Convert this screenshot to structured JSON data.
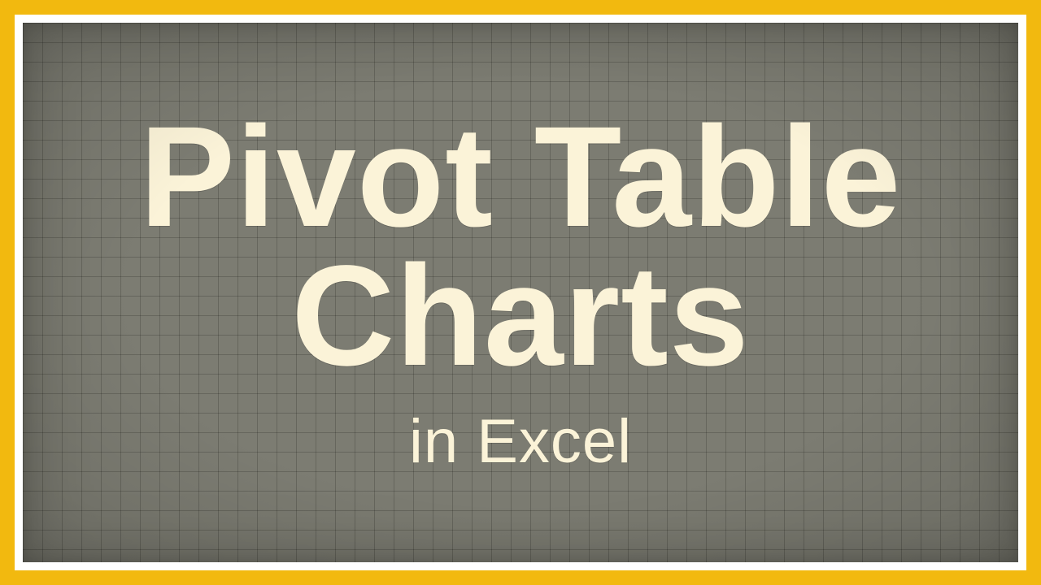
{
  "card": {
    "title_line1": "Pivot Table",
    "title_line2": "Charts",
    "subtitle": "in Excel"
  },
  "colors": {
    "border": "#f2b90f",
    "inner_border": "#ffffff",
    "board": "#7c7c72",
    "text": "#fbf3d8"
  }
}
